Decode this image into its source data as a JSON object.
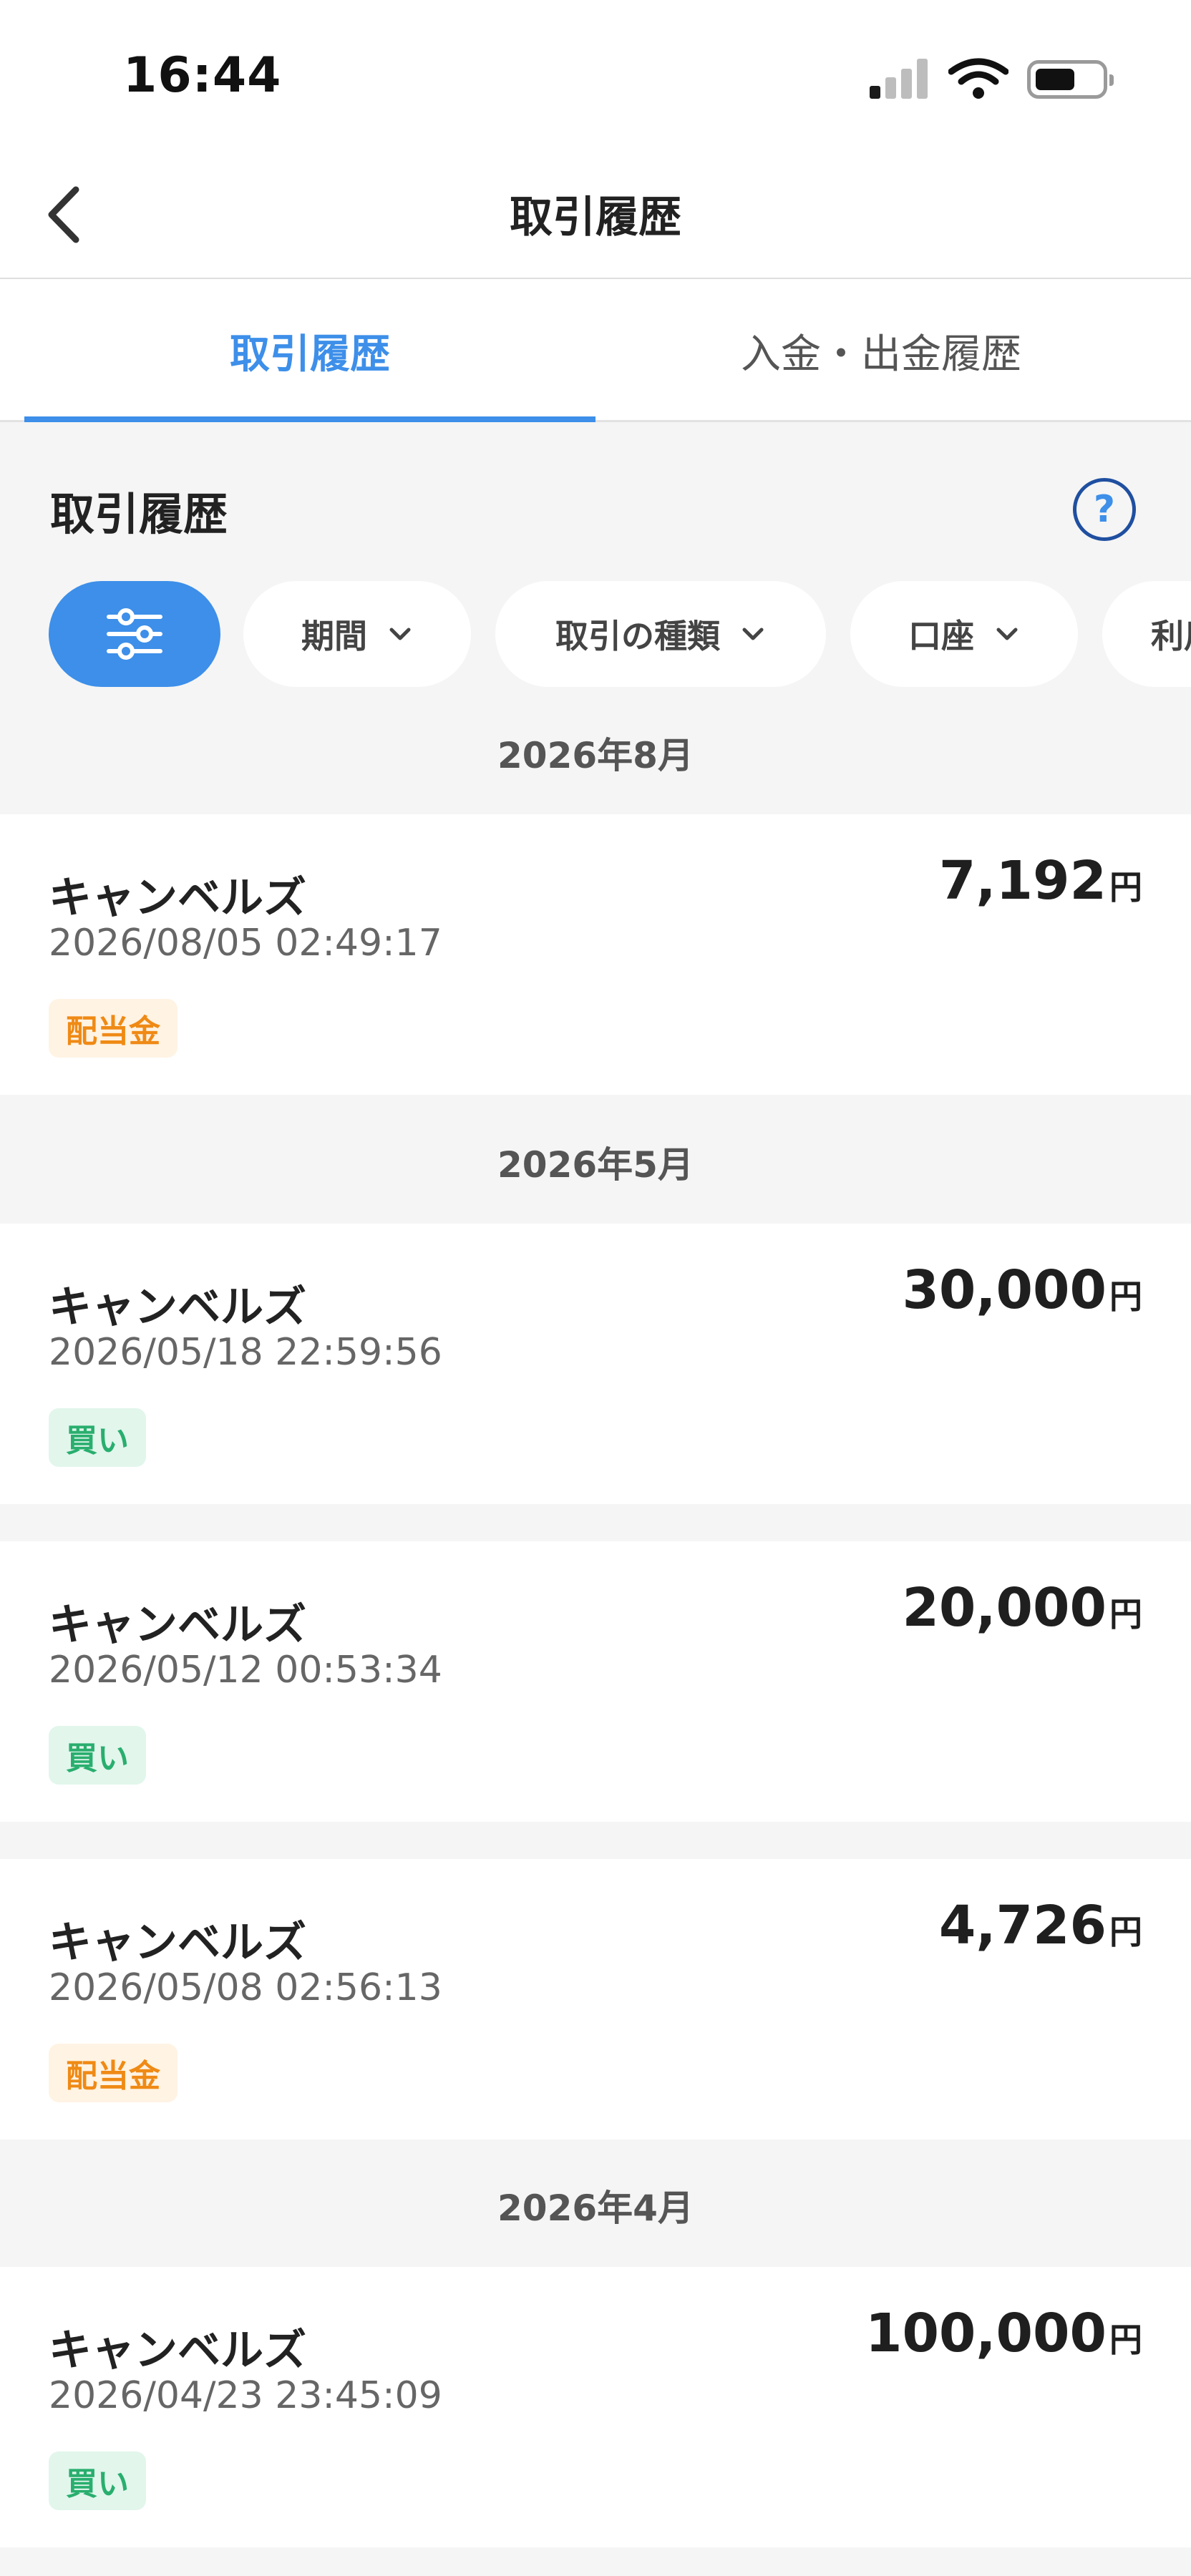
{
  "status_bar": {
    "time": "16:44"
  },
  "header": {
    "title": "取引履歴"
  },
  "tabs": [
    {
      "label": "取引履歴",
      "active": true
    },
    {
      "label": "入金・出金履歴",
      "active": false
    }
  ],
  "section": {
    "title": "取引履歴",
    "help_icon": "?"
  },
  "filters": [
    {
      "label": "期間"
    },
    {
      "label": "取引の種類"
    },
    {
      "label": "口座"
    },
    {
      "label": "利用"
    }
  ],
  "colors": {
    "accent": "#3d8fe9",
    "dividend": "#ef8a15",
    "buy": "#29ae6e"
  },
  "months": [
    "2026年8月",
    "2026年5月",
    "2026年4月"
  ],
  "currency_unit": "円",
  "transactions": [
    {
      "name": "キャンベルズ",
      "datetime": "2026/08/05 02:49:17",
      "amount": "7,192",
      "type": "配当金"
    },
    {
      "name": "キャンベルズ",
      "datetime": "2026/05/18 22:59:56",
      "amount": "30,000",
      "type": "買い"
    },
    {
      "name": "キャンベルズ",
      "datetime": "2026/05/12 00:53:34",
      "amount": "20,000",
      "type": "買い"
    },
    {
      "name": "キャンベルズ",
      "datetime": "2026/05/08 02:56:13",
      "amount": "4,726",
      "type": "配当金"
    },
    {
      "name": "キャンベルズ",
      "datetime": "2026/04/23 23:45:09",
      "amount": "100,000",
      "type": "買い"
    }
  ]
}
